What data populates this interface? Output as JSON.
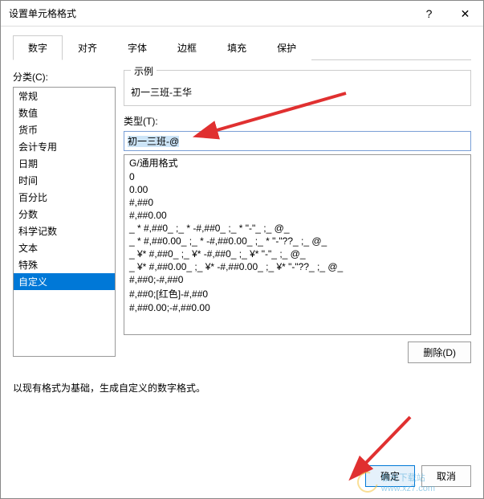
{
  "titlebar": {
    "title": "设置单元格格式",
    "help_icon": "?",
    "close_icon": "✕"
  },
  "tabs": [
    {
      "label": "数字",
      "active": true
    },
    {
      "label": "对齐",
      "active": false
    },
    {
      "label": "字体",
      "active": false
    },
    {
      "label": "边框",
      "active": false
    },
    {
      "label": "填充",
      "active": false
    },
    {
      "label": "保护",
      "active": false
    }
  ],
  "category_label": "分类(C):",
  "categories": [
    "常规",
    "数值",
    "货币",
    "会计专用",
    "日期",
    "时间",
    "百分比",
    "分数",
    "科学记数",
    "文本",
    "特殊",
    "自定义"
  ],
  "category_selected_index": 11,
  "sample": {
    "legend": "示例",
    "value": "初一三班-王华"
  },
  "type_label": "类型(T):",
  "type_value": "初一三班-@",
  "format_list": [
    "G/通用格式",
    "0",
    "0.00",
    "#,##0",
    "#,##0.00",
    "_ * #,##0_ ;_ * -#,##0_ ;_ * \"-\"_ ;_ @_ ",
    "_ * #,##0.00_ ;_ * -#,##0.00_ ;_ * \"-\"??_ ;_ @_ ",
    "_ ¥* #,##0_ ;_ ¥* -#,##0_ ;_ ¥* \"-\"_ ;_ @_ ",
    "_ ¥* #,##0.00_ ;_ ¥* -#,##0.00_ ;_ ¥* \"-\"??_ ;_ @_ ",
    "#,##0;-#,##0",
    "#,##0;[红色]-#,##0",
    "#,##0.00;-#,##0.00"
  ],
  "delete_label": "删除(D)",
  "help_text": "以现有格式为基础，生成自定义的数字格式。",
  "ok_label": "确定",
  "cancel_label": "取消",
  "watermark": {
    "text1": "极光下载站",
    "text2": "www.xz7.com"
  }
}
